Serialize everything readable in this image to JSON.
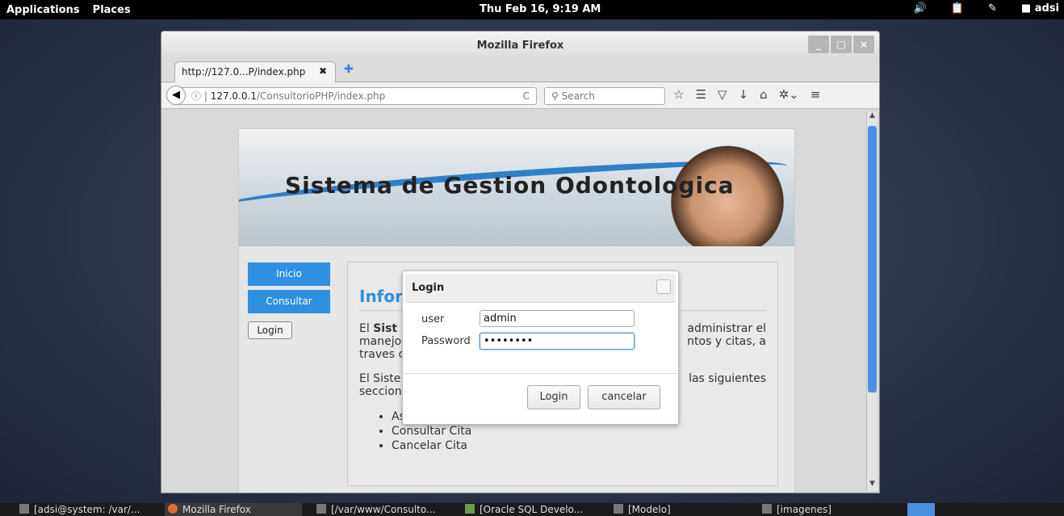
{
  "top_panel": {
    "applications": "Applications",
    "places": "Places",
    "clock": "Thu Feb 16,  9:19 AM",
    "volume_icon": "🔊",
    "clipboard_icon": "📋",
    "user_label": "adsi"
  },
  "firefox": {
    "window_title": "Mozilla Firefox",
    "tab_title": "http://127.0...P/index.php",
    "tab_close": "✖",
    "new_tab": "✚",
    "url_host": "127.0.0.1",
    "url_path": "/ConsultorioPHP/index.php",
    "search_placeholder": "Search",
    "reload": "C",
    "toolbar_icons": [
      "☆",
      "☰",
      "▽",
      "↓",
      "⌂",
      "≡"
    ]
  },
  "page": {
    "banner_title": "Sistema de Gestion Odontologica",
    "menu": {
      "inicio": "Inicio",
      "consultar": "Consultar",
      "login": "Login"
    },
    "heading": "Infor",
    "para1_a": "El ",
    "para1_b": "Sist",
    "para1_right1": "administrar  el",
    "para1_line2_left": "manejo",
    "para1_line2_right": "ntos y citas, a",
    "para1_line3": "traves c",
    "para2_line1_left": "El Siste",
    "para2_line1_right": "las  siguientes",
    "para2_line2": "seccion",
    "list": [
      "Asignar Cita",
      "Consultar Cita",
      "Cancelar Cita"
    ]
  },
  "dialog": {
    "title": "Login",
    "user_label": "user",
    "user_value": "admin",
    "password_label": "Password",
    "password_value": "••••••••",
    "login_button": "Login",
    "cancel_button": "cancelar"
  },
  "taskbar": {
    "items": [
      "[adsi@system: /var/...",
      "Mozilla Firefox",
      "[/var/www/Consulto...",
      "[Oracle SQL Develo...",
      "[Modelo]",
      "[imagenes]"
    ]
  }
}
